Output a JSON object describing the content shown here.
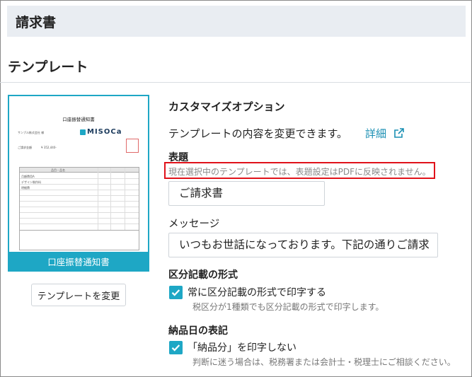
{
  "header": {
    "title": "請求書"
  },
  "section": {
    "title": "テンプレート"
  },
  "preview": {
    "doc_title": "口座振替通知書",
    "footer_label": "口座振替通知書",
    "logo_text": "MISOCa",
    "customer": "サンプル株式会社 様",
    "amount_label": "ご請求金額",
    "amount_value": "¥ 352,440-",
    "table_header": "品目・品名",
    "rows": [
      "月額費用A",
      "デザイン制作料",
      "明細費"
    ]
  },
  "change_button": {
    "label": "テンプレートを変更"
  },
  "options": {
    "title": "カスタマイズオプション",
    "description": "テンプレートの内容を変更できます。",
    "detail_link": "詳細",
    "subject": {
      "label": "表題",
      "warning": "現在選択中のテンプレートでは、表題設定はPDFに反映されません。",
      "value": "ご請求書"
    },
    "message": {
      "label": "メッセージ",
      "value": "いつもお世話になっております。下記の通りご請求"
    },
    "tax_format": {
      "label": "区分記載の形式",
      "checkbox_label": "常に区分記載の形式で印字する",
      "note": "税区分が1種類でも区分記載の形式で印字します。",
      "checked": true
    },
    "delivery_date": {
      "label": "納品日の表記",
      "checkbox_label": "「納品分」を印字しない",
      "note": "判断に迷う場合は、税務署または会計士・税理士にご相談ください。",
      "checked": true
    }
  },
  "colors": {
    "accent": "#1ea7c5",
    "warning_border": "#e0121a",
    "link": "#1a8fb3"
  }
}
